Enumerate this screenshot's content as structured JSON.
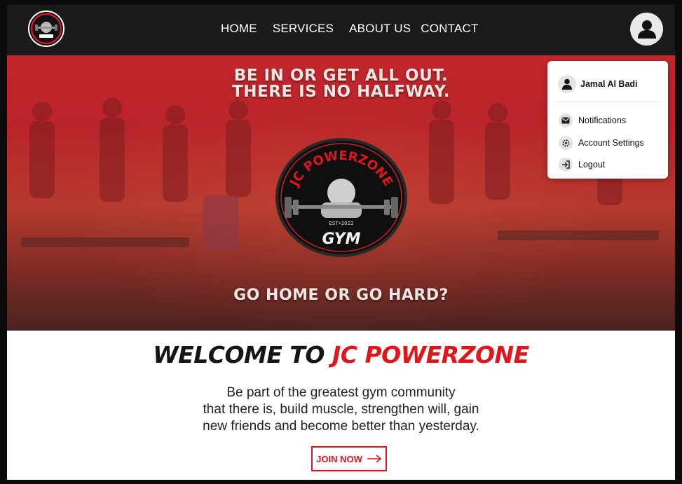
{
  "nav": {
    "links": [
      "HOME",
      "SERVICES",
      "ABOUT US",
      "CONTACT"
    ]
  },
  "hero": {
    "tagline_line1": "BE IN OR GET ALL OUT.",
    "tagline_line2": "THERE IS NO HALFWAY.",
    "tagline_bottom": "GO HOME OR GO HARD?",
    "logo_top": "JC POWERZONE",
    "logo_est": "EST•2022",
    "logo_bottom": "GYM"
  },
  "welcome": {
    "prefix": "WELCOME TO",
    "brand": "JC POWERZONE",
    "desc_line1": "Be part of the greatest gym community",
    "desc_line2": "that there is, build muscle, strengthen will, gain",
    "desc_line3": "new friends and become better than yesterday.",
    "cta": "JOIN NOW"
  },
  "user_menu": {
    "user_name": "Jamal Al Badi",
    "items": [
      "Notifications",
      "Account Settings",
      "Logout"
    ]
  },
  "colors": {
    "accent": "#e0161d",
    "nav_bg": "#1b1b1b",
    "hero_red": "#c4262c"
  },
  "icons": [
    "user-avatar-icon",
    "mail-icon",
    "gear-icon",
    "logout-icon",
    "arrow-right-icon"
  ]
}
